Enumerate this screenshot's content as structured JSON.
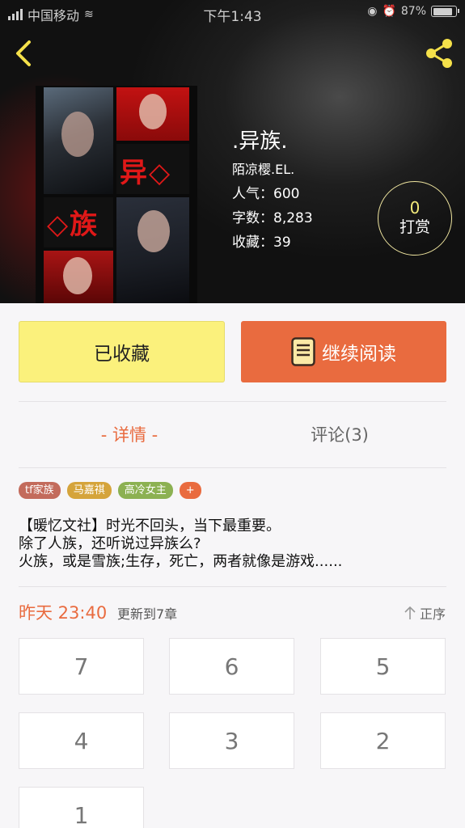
{
  "status_bar": {
    "carrier": "中国移动",
    "time": "下午1:43",
    "battery_text": "87%",
    "battery_level": 0.87
  },
  "header": {
    "back_icon": "chevron-left-icon",
    "share_icon": "share-icon"
  },
  "book": {
    "title": ".异族.",
    "author": "陌凉樱.EL.",
    "popularity": "人气：600",
    "word_count": "字数：8,283",
    "favorites": "收藏：39",
    "cover_text_1": "异◇",
    "cover_text_2": "◇族"
  },
  "tip": {
    "count": "0",
    "label": "打赏"
  },
  "actions": {
    "favorite_label": "已收藏",
    "continue_label": "继续阅读",
    "continue_icon": "book-icon"
  },
  "tabs": {
    "detail": "- 详情 -",
    "comments": "评论(3)"
  },
  "tags": [
    {
      "label": "tf家族",
      "color": "#c36b5c"
    },
    {
      "label": "马嘉祺",
      "color": "#d5a43b"
    },
    {
      "label": "高冷女主",
      "color": "#8cb152"
    },
    {
      "label": "+",
      "color": "#e96b3f"
    }
  ],
  "synopsis": [
    "【暖忆文社】时光不回头，当下最重要。",
    "除了人族，还听说过异族么?",
    "火族，或是雪族;生存，死亡，两者就像是游戏......"
  ],
  "update": {
    "time": "昨天 23:40",
    "chapter_text": "更新到7章",
    "sort_label": "正序"
  },
  "chapters": [
    "7",
    "6",
    "5",
    "4",
    "3",
    "2",
    "1"
  ],
  "colors": {
    "accent": "#e96b3f",
    "favorite_bg": "#fbf17c",
    "tip_count": "#f3ea7a"
  }
}
